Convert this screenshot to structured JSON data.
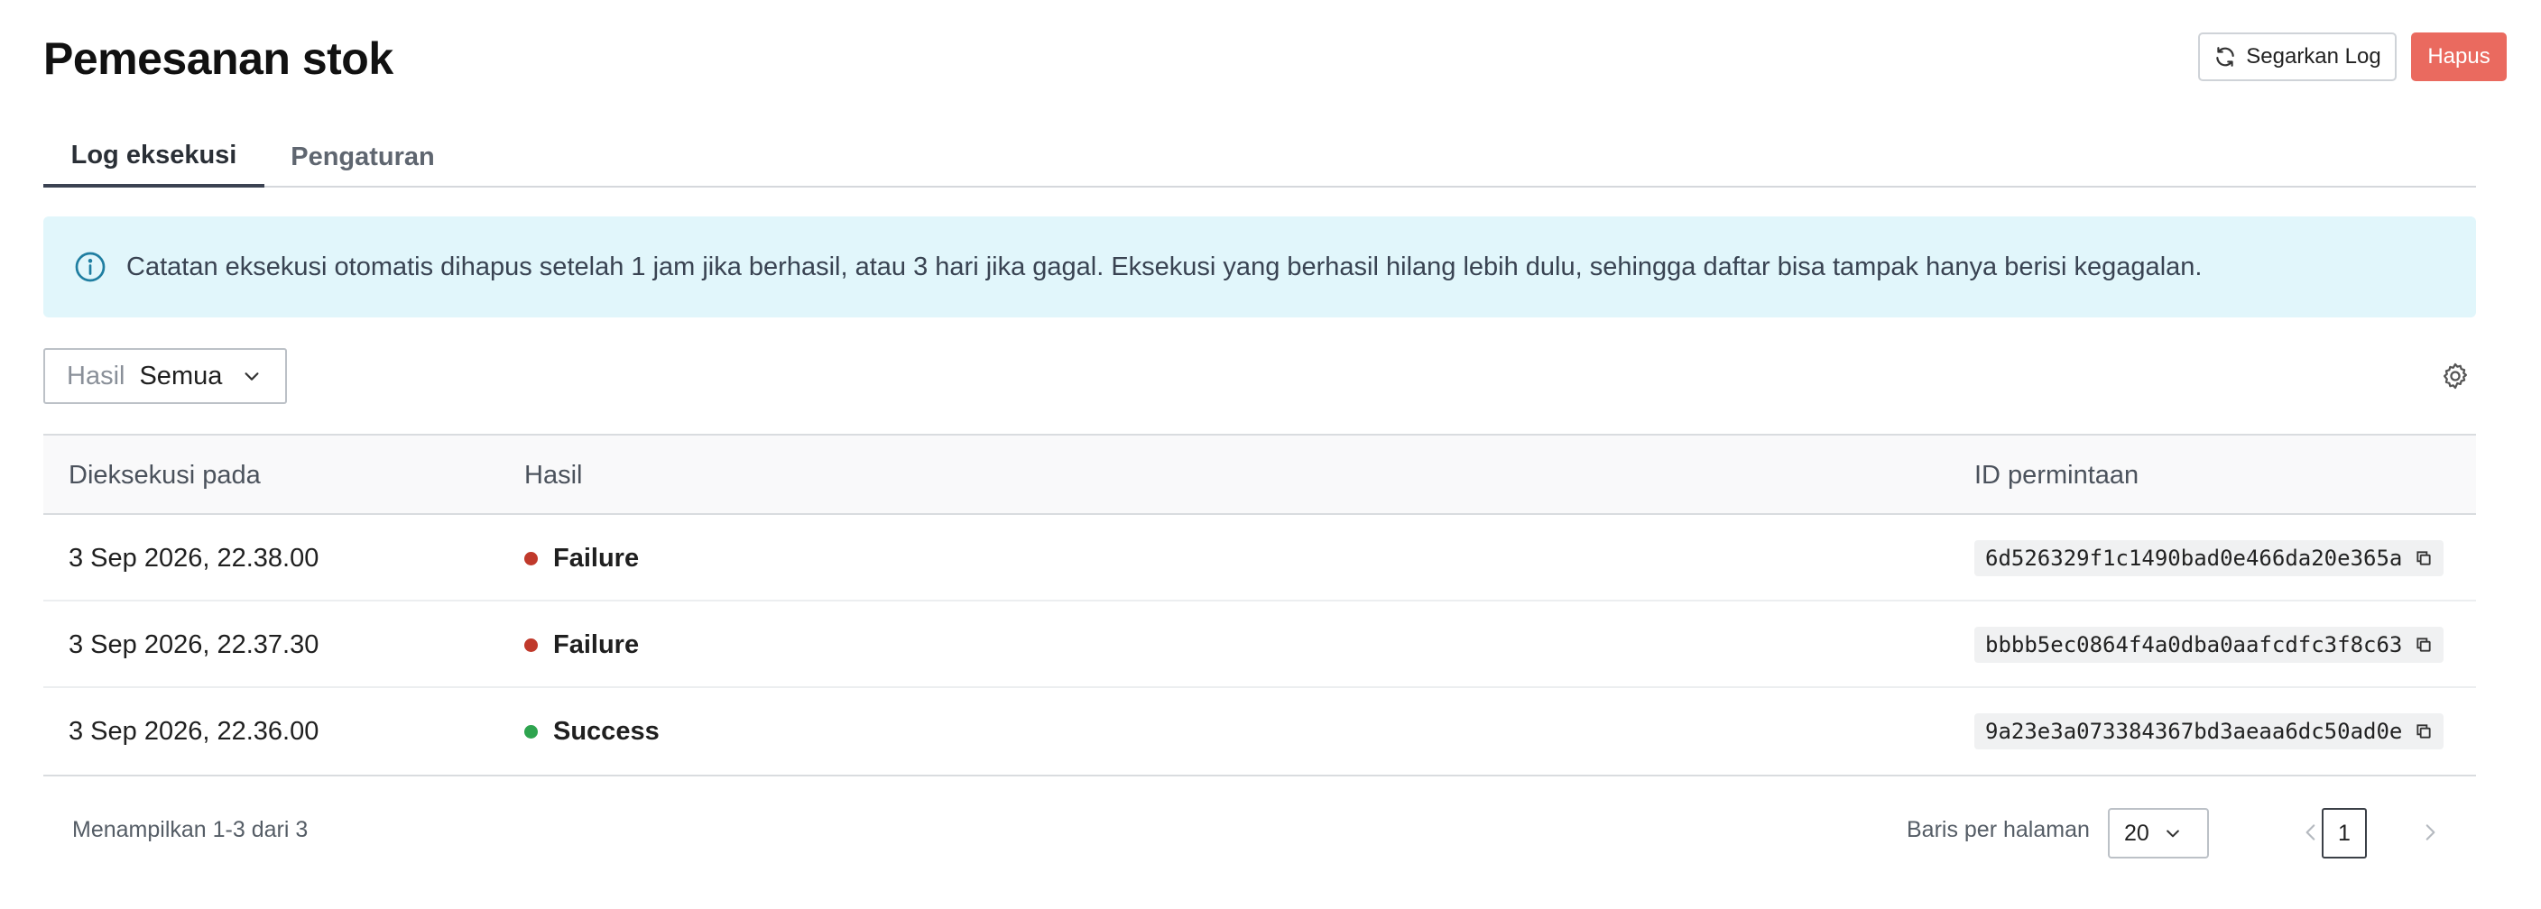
{
  "header": {
    "title": "Pemesanan stok",
    "refresh_label": "Segarkan Log",
    "delete_label": "Hapus"
  },
  "tabs": [
    {
      "label": "Log eksekusi",
      "active": true
    },
    {
      "label": "Pengaturan",
      "active": false
    }
  ],
  "banner": {
    "icon": "info-icon",
    "text": "Catatan eksekusi otomatis dihapus setelah 1 jam jika berhasil, atau 3 hari jika gagal. Eksekusi yang berhasil hilang lebih dulu, sehingga daftar bisa tampak hanya berisi kegagalan."
  },
  "filter": {
    "label": "Hasil",
    "value": "Semua"
  },
  "table": {
    "columns": [
      "Dieksekusi pada",
      "Hasil",
      "ID permintaan"
    ],
    "rows": [
      {
        "executed_at": "3 Sep 2026, 22.38.00",
        "result": "Failure",
        "status_color": "#c0392b",
        "request_id": "6d526329f1c1490bad0e466da20e365a"
      },
      {
        "executed_at": "3 Sep 2026, 22.37.30",
        "result": "Failure",
        "status_color": "#c0392b",
        "request_id": "bbbb5ec0864f4a0dba0aafcdfc3f8c63"
      },
      {
        "executed_at": "3 Sep 2026, 22.36.00",
        "result": "Success",
        "status_color": "#2ea44f",
        "request_id": "9a23e3a073384367bd3aeaa6dc50ad0e"
      }
    ]
  },
  "pagination": {
    "summary": "Menampilkan 1-3 dari 3",
    "rows_per_page_label": "Baris per halaman",
    "rows_per_page": "20",
    "current_page": "1"
  },
  "colors": {
    "delete": "#ea6a5f",
    "banner_bg": "#e1f6fb",
    "info_icon": "#1f7ea1"
  }
}
